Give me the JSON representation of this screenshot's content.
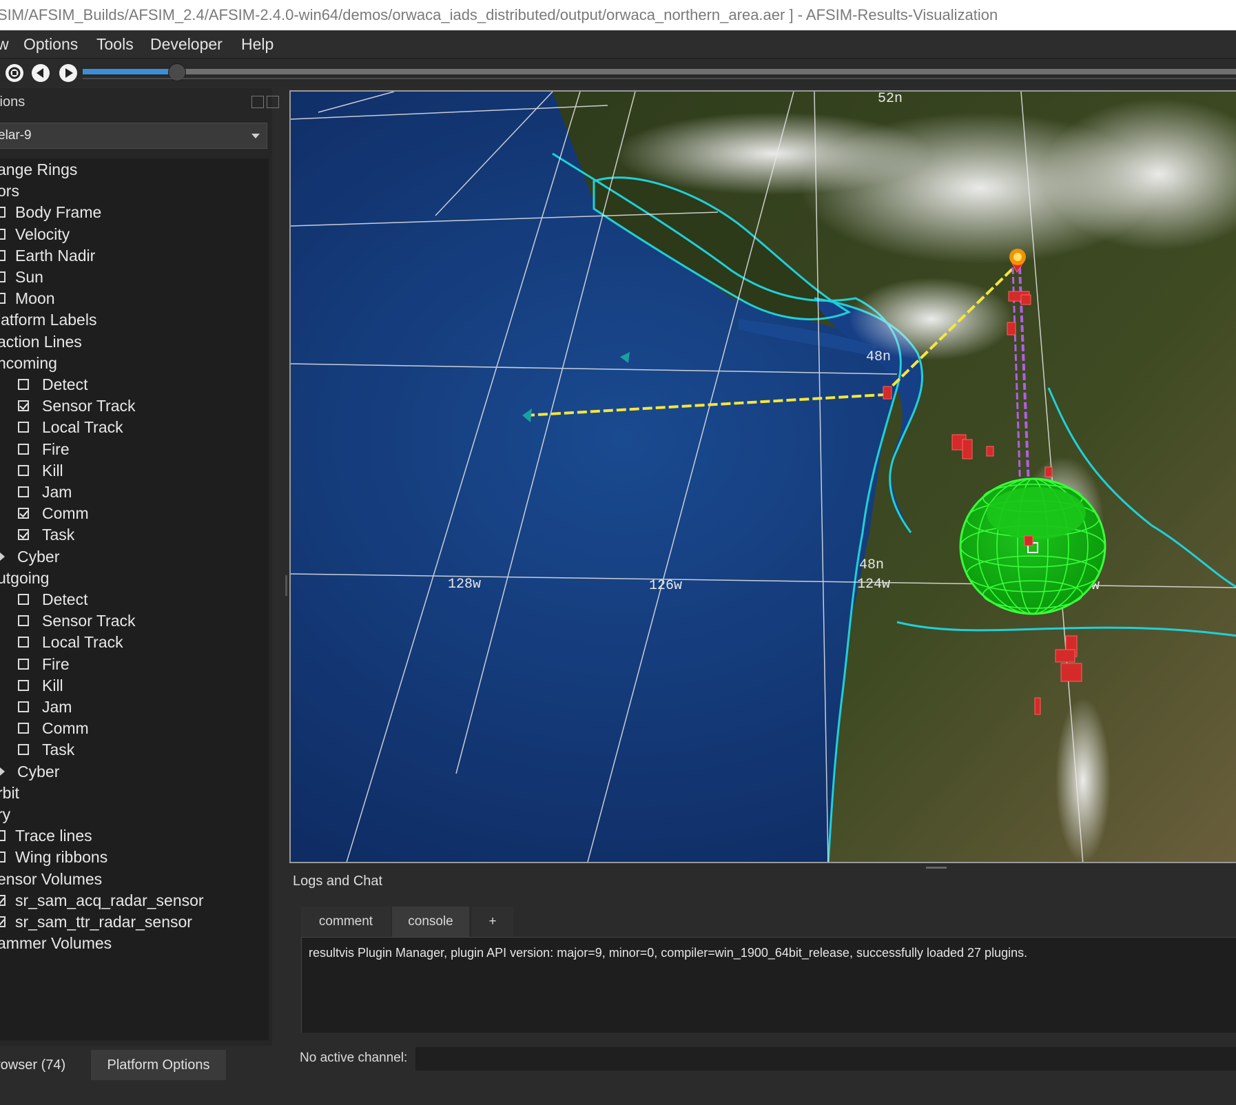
{
  "window": {
    "title": "SIM/AFSIM_Builds/AFSIM_2.4/AFSIM-2.4.0-win64/demos/orwaca_iads_distributed/output/orwaca_northern_area.aer ] - AFSIM-Results-Visualization"
  },
  "menu": {
    "items": [
      "w",
      "Options",
      "Tools",
      "Developer",
      "Help"
    ]
  },
  "playback": {
    "progress_fraction": 0.08
  },
  "left_panel": {
    "title": "tions",
    "platform_select": "elar-9",
    "tree": [
      {
        "label": "ange Rings",
        "checkbox": null
      },
      {
        "label": "ors",
        "checkbox": null
      },
      {
        "label": "Body Frame",
        "checkbox": false
      },
      {
        "label": "Velocity",
        "checkbox": false
      },
      {
        "label": "Earth Nadir",
        "checkbox": false
      },
      {
        "label": "Sun",
        "checkbox": false
      },
      {
        "label": "Moon",
        "checkbox": false
      },
      {
        "label": "latform Labels",
        "checkbox": null
      },
      {
        "label": "action Lines",
        "checkbox": null
      },
      {
        "label": "ncoming",
        "checkbox": null
      },
      {
        "label": "Detect",
        "checkbox": false
      },
      {
        "label": "Sensor Track",
        "checkbox": true
      },
      {
        "label": "Local Track",
        "checkbox": false
      },
      {
        "label": "Fire",
        "checkbox": false
      },
      {
        "label": "Kill",
        "checkbox": false
      },
      {
        "label": "Jam",
        "checkbox": false
      },
      {
        "label": "Comm",
        "checkbox": true
      },
      {
        "label": "Task",
        "checkbox": true
      },
      {
        "label": "Cyber",
        "checkbox": null
      },
      {
        "label": "utgoing",
        "checkbox": null
      },
      {
        "label": "Detect",
        "checkbox": false
      },
      {
        "label": "Sensor Track",
        "checkbox": false
      },
      {
        "label": "Local Track",
        "checkbox": false
      },
      {
        "label": "Fire",
        "checkbox": false
      },
      {
        "label": "Kill",
        "checkbox": false
      },
      {
        "label": "Jam",
        "checkbox": false
      },
      {
        "label": "Comm",
        "checkbox": false
      },
      {
        "label": "Task",
        "checkbox": false
      },
      {
        "label": "Cyber",
        "checkbox": null
      },
      {
        "label": "rbit",
        "checkbox": null
      },
      {
        "label": "ry",
        "checkbox": null
      },
      {
        "label": "Trace lines",
        "checkbox": false
      },
      {
        "label": "Wing ribbons",
        "checkbox": false
      },
      {
        "label": "ensor Volumes",
        "checkbox": null
      },
      {
        "label": "sr_sam_acq_radar_sensor",
        "checkbox": true
      },
      {
        "label": "sr_sam_ttr_radar_sensor",
        "checkbox": true
      },
      {
        "label": "ammer Volumes",
        "checkbox": null
      }
    ]
  },
  "bottom_tabs": [
    "rowser (74)",
    "Platform Options"
  ],
  "map": {
    "grid_labels": {
      "lat_52": "52n",
      "lat_48a": "48n",
      "lat_48b": "48n",
      "lon_128": "128w",
      "lon_126": "126w",
      "lon_124": "124w",
      "lon_w": "w"
    },
    "colors": {
      "ocean": "#123a78",
      "land": "#3c4a22",
      "coast": "#20d0d8",
      "grid": "#e8e8e8",
      "comm_line": "#f5e63c",
      "task_line": "#b060e0",
      "sensor_volume": "#39ff3a",
      "platform": "#d42a2a"
    }
  },
  "logs": {
    "title": "Logs and Chat",
    "tabs": [
      "comment",
      "console",
      "+"
    ],
    "active_tab": "console",
    "lines": [
      "resultvis Plugin Manager, plugin API version: major=9, minor=0, compiler=win_1900_64bit_release, successfully loaded 27 plugins."
    ],
    "channel_label": "No active channel:",
    "channel_value": ""
  }
}
